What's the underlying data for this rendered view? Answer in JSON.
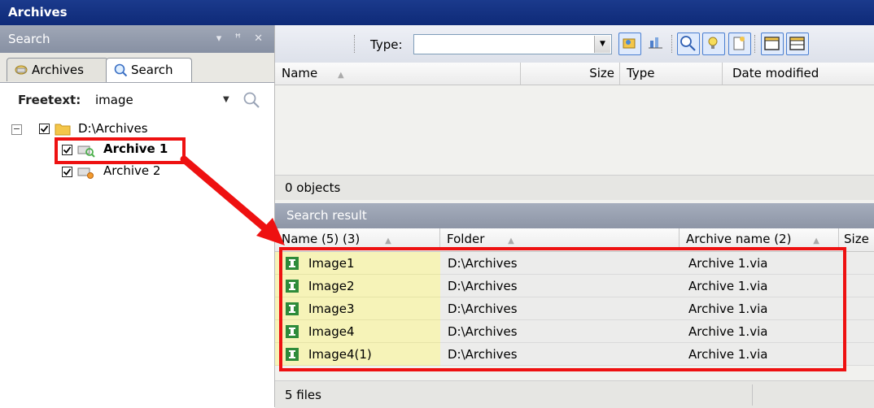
{
  "window": {
    "title": "Archives"
  },
  "left_panel": {
    "title": "Search",
    "controls": "▾ ꟸ ✕",
    "tabs": [
      {
        "label": "Archives",
        "icon": "archive-icon"
      },
      {
        "label": "Search",
        "icon": "search-icon"
      }
    ],
    "freetext": {
      "label": "Freetext:",
      "value": "image"
    },
    "tree": {
      "root": {
        "label": "D:\\Archives",
        "checked": true,
        "icon": "folder-icon"
      },
      "children": [
        {
          "label": "Archive 1",
          "checked": true,
          "icon": "archive-search-icon"
        },
        {
          "label": "Archive 2",
          "checked": true,
          "icon": "archive-icon"
        }
      ]
    }
  },
  "toolbar": {
    "type_label": "Type:",
    "type_value": ""
  },
  "top_list": {
    "columns": [
      "Name",
      "Size",
      "Type",
      "Date modified"
    ],
    "status": "0 objects"
  },
  "search_result": {
    "title": "Search result",
    "columns": [
      "Name (5) (3)",
      "Folder",
      "Archive name (2)",
      "Size"
    ],
    "rows": [
      {
        "name": "Image1",
        "folder": "D:\\Archives",
        "archive": "Archive 1.via"
      },
      {
        "name": "Image2",
        "folder": "D:\\Archives",
        "archive": "Archive 1.via"
      },
      {
        "name": "Image3",
        "folder": "D:\\Archives",
        "archive": "Archive 1.via"
      },
      {
        "name": "Image4",
        "folder": "D:\\Archives",
        "archive": "Archive 1.via"
      },
      {
        "name": "Image4(1)",
        "folder": "D:\\Archives",
        "archive": "Archive 1.via"
      }
    ],
    "status": "5 files"
  },
  "colors": {
    "title_bar": "#0e2a78",
    "pane_header": "#8f98aa",
    "highlight_name": "#f6f3b8",
    "annotation": "#ee1111"
  }
}
